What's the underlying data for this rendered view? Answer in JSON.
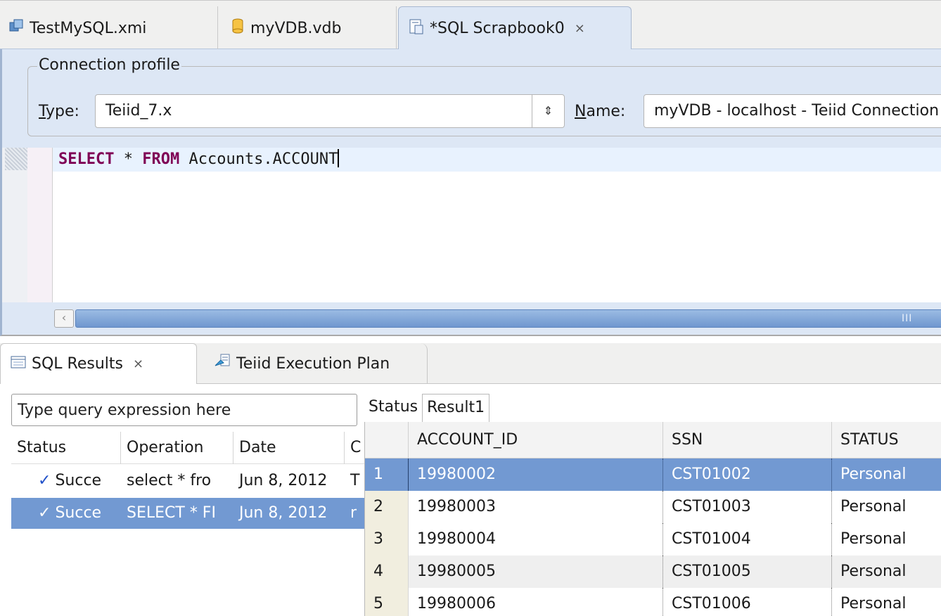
{
  "editor_tabs": [
    {
      "label": "TestMySQL.xmi",
      "icon": "model-icon",
      "active": false
    },
    {
      "label": "myVDB.vdb",
      "icon": "database-icon",
      "active": false
    },
    {
      "label": "*SQL Scrapbook0",
      "icon": "scrapbook-icon",
      "active": true,
      "close": "⨯"
    }
  ],
  "connection": {
    "legend": "Connection profile",
    "type_label_mnemonic": "T",
    "type_label_rest": "ype:",
    "type_value": "Teiid_7.x",
    "name_label_mnemonic": "N",
    "name_label_rest": "ame:",
    "name_value": "myVDB - localhost - Teiid Connection"
  },
  "sql": {
    "kw_select": "SELECT",
    "star": "*",
    "kw_from": "FROM",
    "table": "Accounts.ACCOUNT"
  },
  "editor_scroll": {
    "grip": "III"
  },
  "view_tabs": [
    {
      "label": "SQL Results",
      "icon": "results-icon",
      "active": true,
      "close": "⨯"
    },
    {
      "label": "Teiid Execution Plan",
      "icon": "execution-plan-icon",
      "active": false
    }
  ],
  "history": {
    "filter_placeholder": "Type query expression here",
    "columns": [
      "Status",
      "Operation",
      "Date",
      "C"
    ],
    "rows": [
      {
        "status": "Succe",
        "operation": "select * fro",
        "date": "Jun 8, 2012",
        "extra": "T",
        "selected": false
      },
      {
        "status": "Succe",
        "operation": "SELECT * FI",
        "date": "Jun 8, 2012",
        "extra": "r",
        "selected": true
      }
    ]
  },
  "result_tabs": [
    "Status",
    "Result1"
  ],
  "result_grid": {
    "columns": [
      "",
      "ACCOUNT_ID",
      "SSN",
      "STATUS"
    ],
    "rows": [
      {
        "n": "1",
        "account_id": "19980002",
        "ssn": "CST01002",
        "status": "Personal",
        "selected": true
      },
      {
        "n": "2",
        "account_id": "19980003",
        "ssn": "CST01003",
        "status": "Personal",
        "selected": false
      },
      {
        "n": "3",
        "account_id": "19980004",
        "ssn": "CST01004",
        "status": "Personal",
        "selected": false
      },
      {
        "n": "4",
        "account_id": "19980005",
        "ssn": "CST01005",
        "status": "Personal",
        "selected": false
      },
      {
        "n": "5",
        "account_id": "19980006",
        "ssn": "CST01006",
        "status": "Personal",
        "selected": false
      }
    ]
  },
  "colors": {
    "selection": "#7299d2",
    "keyword": "#7f0055",
    "editor_bg": "#dde7f5",
    "check": "#2151c9"
  }
}
